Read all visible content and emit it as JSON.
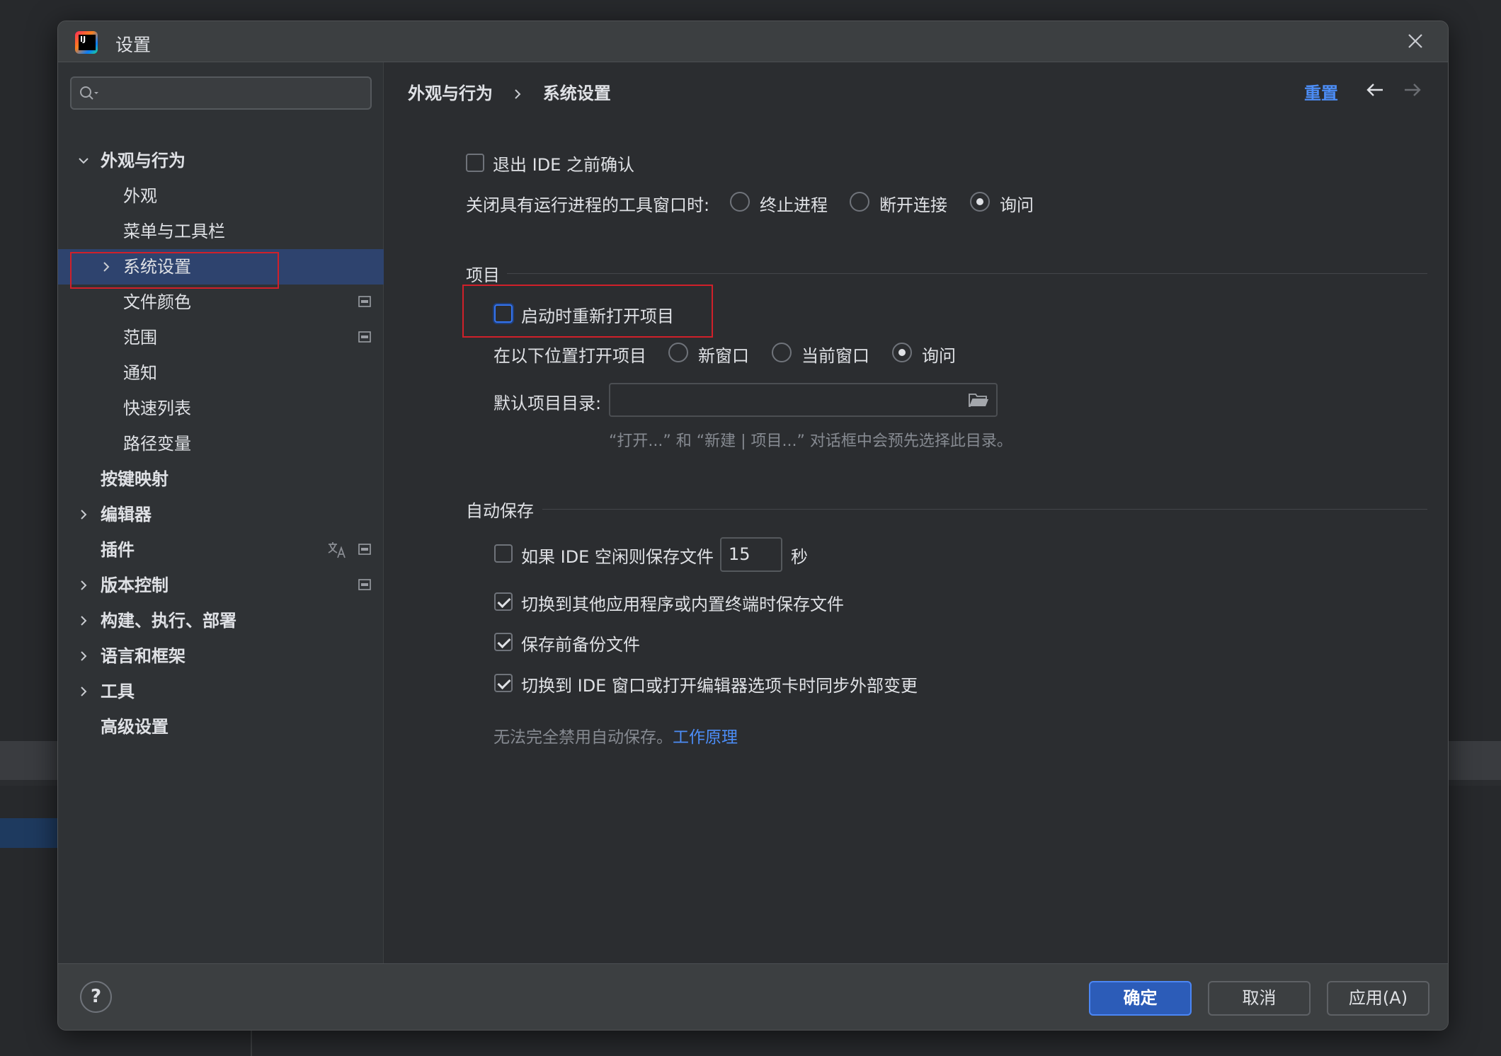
{
  "window": {
    "title": "设置"
  },
  "sidebar": {
    "search": {
      "placeholder": ""
    },
    "items": [
      {
        "label": "外观与行为",
        "bold": true,
        "expanded": true
      },
      {
        "label": "外观"
      },
      {
        "label": "菜单与工具栏"
      },
      {
        "label": "系统设置",
        "selected": true
      },
      {
        "label": "文件颜色"
      },
      {
        "label": "范围"
      },
      {
        "label": "通知"
      },
      {
        "label": "快速列表"
      },
      {
        "label": "路径变量"
      },
      {
        "label": "按键映射",
        "bold": true
      },
      {
        "label": "编辑器",
        "bold": true
      },
      {
        "label": "插件",
        "bold": true
      },
      {
        "label": "版本控制",
        "bold": true
      },
      {
        "label": "构建、执行、部署",
        "bold": true
      },
      {
        "label": "语言和框架",
        "bold": true
      },
      {
        "label": "工具",
        "bold": true
      },
      {
        "label": "高级设置",
        "bold": true
      }
    ]
  },
  "header": {
    "breadcrumb": [
      "外观与行为",
      "系统设置"
    ],
    "reset_label": "重置"
  },
  "general": {
    "confirm_exit": {
      "label": "退出 IDE 之前确认",
      "checked": false
    },
    "close_tool_window_label": "关闭具有运行进程的工具窗口时:",
    "close_options": [
      {
        "label": "终止进程",
        "checked": false
      },
      {
        "label": "断开连接",
        "checked": false
      },
      {
        "label": "询问",
        "checked": true
      }
    ]
  },
  "project": {
    "section_title": "项目",
    "reopen": {
      "label": "启动时重新打开项目",
      "checked": false
    },
    "open_in_label": "在以下位置打开项目",
    "open_options": [
      {
        "label": "新窗口",
        "checked": false
      },
      {
        "label": "当前窗口",
        "checked": false
      },
      {
        "label": "询问",
        "checked": true
      }
    ],
    "default_dir_label": "默认项目目录:",
    "default_dir_value": "",
    "default_dir_hint": "“打开...” 和 “新建 | 项目...” 对话框中会预先选择此目录。"
  },
  "autosave": {
    "section_title": "自动保存",
    "idle_save": {
      "label": "如果 IDE 空闲则保存文件",
      "checked": false,
      "seconds": "15",
      "unit": "秒"
    },
    "switch_save": {
      "label": "切换到其他应用程序或内置终端时保存文件",
      "checked": true
    },
    "backup": {
      "label": "保存前备份文件",
      "checked": true
    },
    "sync": {
      "label": "切换到 IDE 窗口或打开编辑器选项卡时同步外部变更",
      "checked": true
    },
    "note": "无法完全禁用自动保存。",
    "note_link": "工作原理"
  },
  "footer": {
    "help": "?",
    "ok_label": "确定",
    "cancel_label": "取消",
    "apply_label": "应用(A)"
  },
  "colors": {
    "accent": "#3574f0",
    "link": "#4c8df6",
    "highlight_box": "#d0202a",
    "selected_row": "#2e436e"
  }
}
